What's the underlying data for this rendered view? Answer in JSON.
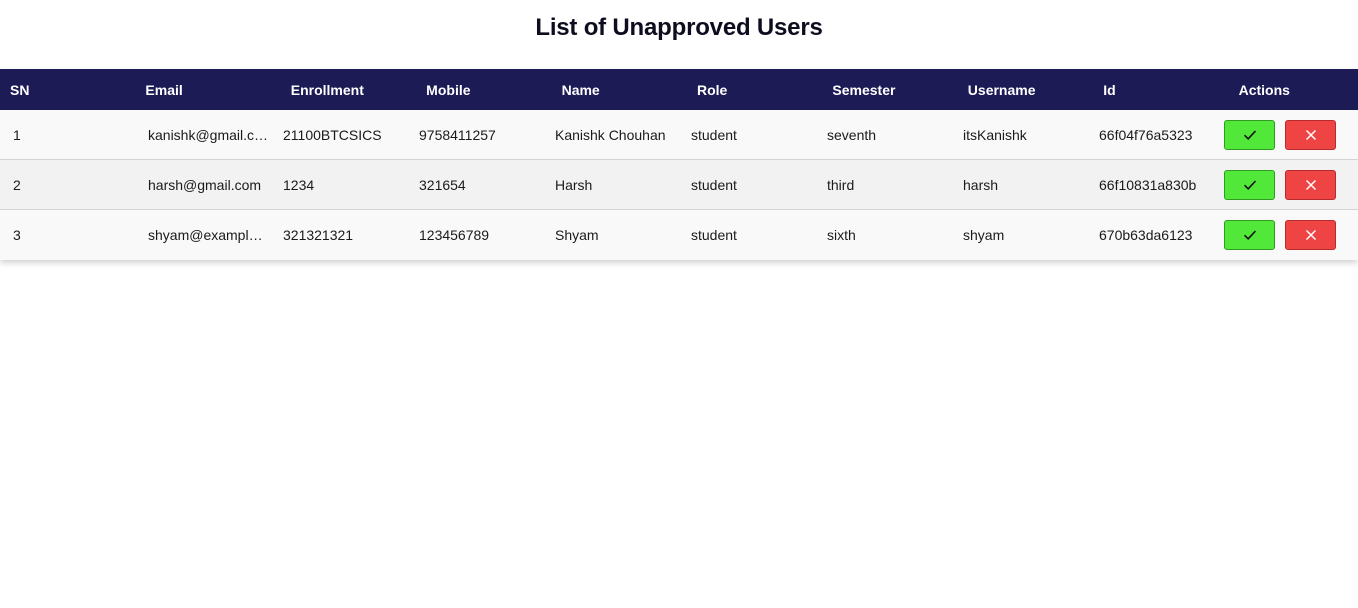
{
  "page": {
    "title": "List of Unapproved Users"
  },
  "table": {
    "headers": [
      "SN",
      "Email",
      "Enrollment",
      "Mobile",
      "Name",
      "Role",
      "Semester",
      "Username",
      "Id",
      "Actions"
    ],
    "rows": [
      {
        "sn": "1",
        "email": "kanishk@gmail.com",
        "enrollment": "21100BTCSICS",
        "mobile": "9758411257",
        "name": "Kanishk Chouhan",
        "role": "student",
        "semester": "seventh",
        "username": "itsKanishk",
        "id": "66f04f76a5323"
      },
      {
        "sn": "2",
        "email": "harsh@gmail.com",
        "enrollment": "1234",
        "mobile": "321654",
        "name": "Harsh",
        "role": "student",
        "semester": "third",
        "username": "harsh",
        "id": "66f10831a830b"
      },
      {
        "sn": "3",
        "email": "shyam@example.com",
        "enrollment": "321321321",
        "mobile": "123456789",
        "name": "Shyam",
        "role": "student",
        "semester": "sixth",
        "username": "shyam",
        "id": "670b63da6123"
      }
    ],
    "actions": {
      "approve_icon": "check-icon",
      "reject_icon": "close-icon"
    }
  },
  "colors": {
    "header_bg": "#1d1b55",
    "approve": "#52e83a",
    "reject": "#ef4444"
  }
}
